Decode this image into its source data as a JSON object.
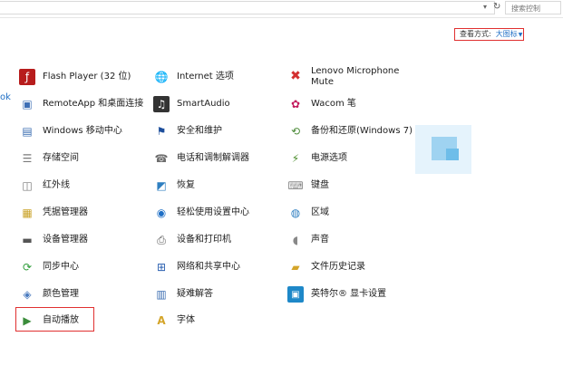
{
  "toolbar": {
    "search_placeholder": "搜索控制"
  },
  "view_by": {
    "label": "查看方式:",
    "value": "大图标"
  },
  "edge_text": "ok",
  "items": [
    {
      "label": "Flash Player (32 位)",
      "icon": "flash-icon",
      "color": "#b71c1c"
    },
    {
      "label": "Internet 选项",
      "icon": "globe-icon",
      "color": "#2f7fc1"
    },
    {
      "label": "Lenovo Microphone Mute",
      "icon": "microphone-mute-icon",
      "color": "#d32f2f"
    },
    {
      "label": "RemoteApp 和桌面连接",
      "icon": "remote-desktop-icon",
      "color": "#3d6fb5"
    },
    {
      "label": "SmartAudio",
      "icon": "headphones-icon",
      "color": "#333333"
    },
    {
      "label": "Wacom 笔",
      "icon": "pen-icon",
      "color": "#c2185b"
    },
    {
      "label": "Windows 移动中心",
      "icon": "mobility-center-icon",
      "color": "#3b6db1"
    },
    {
      "label": "安全和维护",
      "icon": "flag-icon",
      "color": "#1e4f9c"
    },
    {
      "label": "备份和还原(Windows 7)",
      "icon": "backup-icon",
      "color": "#4e8c3a"
    },
    {
      "label": "存储空间",
      "icon": "storage-icon",
      "color": "#7a7a7a"
    },
    {
      "label": "电话和调制解调器",
      "icon": "phone-modem-icon",
      "color": "#6d6d6d"
    },
    {
      "label": "电源选项",
      "icon": "power-icon",
      "color": "#4a8c2a"
    },
    {
      "label": "红外线",
      "icon": "infrared-icon",
      "color": "#777777"
    },
    {
      "label": "恢复",
      "icon": "recovery-icon",
      "color": "#2f7fc1"
    },
    {
      "label": "键盘",
      "icon": "keyboard-icon",
      "color": "#8a8a8a"
    },
    {
      "label": "凭据管理器",
      "icon": "credential-icon",
      "color": "#c9a227"
    },
    {
      "label": "轻松使用设置中心",
      "icon": "ease-of-access-icon",
      "color": "#1f6fc5"
    },
    {
      "label": "区域",
      "icon": "region-icon",
      "color": "#2f7fc1"
    },
    {
      "label": "设备管理器",
      "icon": "device-manager-icon",
      "color": "#555555"
    },
    {
      "label": "设备和打印机",
      "icon": "printer-icon",
      "color": "#555555"
    },
    {
      "label": "声音",
      "icon": "speaker-icon",
      "color": "#888888"
    },
    {
      "label": "同步中心",
      "icon": "sync-icon",
      "color": "#2e9d3a"
    },
    {
      "label": "网络和共享中心",
      "icon": "network-icon",
      "color": "#2a5fb0"
    },
    {
      "label": "文件历史记录",
      "icon": "file-history-icon",
      "color": "#d4a52a"
    },
    {
      "label": "颜色管理",
      "icon": "color-management-icon",
      "color": "#4a7bbf"
    },
    {
      "label": "疑难解答",
      "icon": "troubleshooting-icon",
      "color": "#3b6db1"
    },
    {
      "label": "英特尔® 显卡设置",
      "icon": "graphics-icon",
      "color": "#1e88c8"
    },
    {
      "label": "自动播放",
      "icon": "autoplay-icon",
      "color": "#3a8c3a"
    },
    {
      "label": "字体",
      "icon": "fonts-icon",
      "color": "#d4a52a"
    }
  ]
}
